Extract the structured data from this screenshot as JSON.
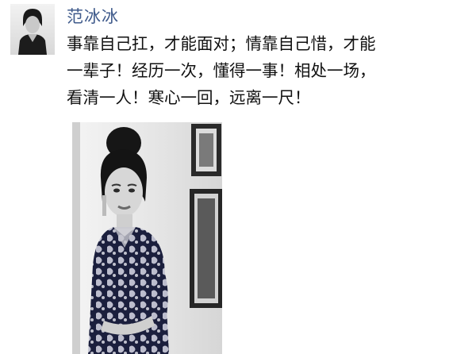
{
  "post": {
    "author_name": "范冰冰",
    "text_lines": [
      "事靠自己扛，才能面对；情靠自己惜，才能",
      "一辈子！经历一次，懂得一事！相处一场，",
      "看清一人！寒心一回，远离一尺！"
    ]
  }
}
